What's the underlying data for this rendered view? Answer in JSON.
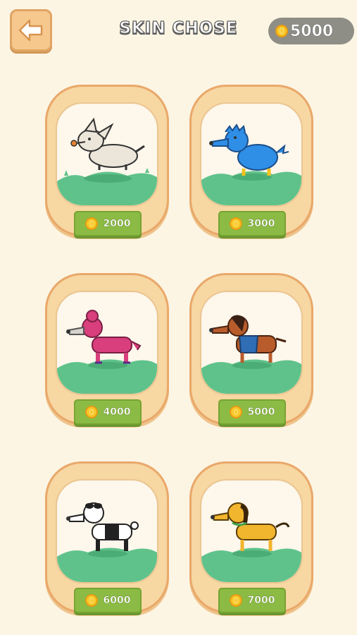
{
  "header": {
    "title": "SKIN CHOSE",
    "coins": "5000",
    "back_icon": "arrow-left-icon"
  },
  "colors": {
    "background": "#fdf5e4",
    "card": "#f7d7a2",
    "card_border": "#e9a86a",
    "price_button": "#8bbb45",
    "coin_pill": "#8e8e86",
    "grass": "#5fc28a"
  },
  "skins": [
    {
      "name": "white-dog",
      "price": "2000",
      "color": "#ece6da"
    },
    {
      "name": "blue-dog",
      "price": "3000",
      "color": "#2f8ee6"
    },
    {
      "name": "pink-dog",
      "price": "4000",
      "color": "#d83f7c"
    },
    {
      "name": "brown-dog",
      "price": "5000",
      "color": "#b85c2c"
    },
    {
      "name": "panda-dog",
      "price": "6000",
      "color": "#ffffff"
    },
    {
      "name": "yellow-dog",
      "price": "7000",
      "color": "#f1b52e"
    }
  ]
}
